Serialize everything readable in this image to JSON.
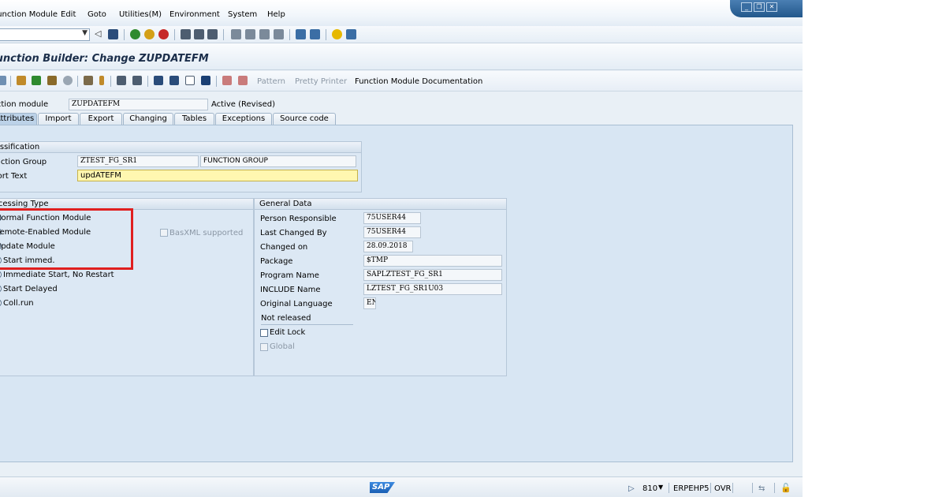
{
  "menu": [
    "Function Module",
    "Edit",
    "Goto",
    "Utilities(M)",
    "Environment",
    "System",
    "Help"
  ],
  "title": "Function Builder: Change ZUPDATEFM",
  "app_toolbar": {
    "pattern": "Pattern",
    "pretty_printer": "Pretty Printer",
    "fm_doc": "Function Module Documentation"
  },
  "header": {
    "fm_label": "Function module",
    "fm_value": "ZUPDATEFM",
    "status": "Active (Revised)"
  },
  "tabs": [
    "Attributes",
    "Import",
    "Export",
    "Changing",
    "Tables",
    "Exceptions",
    "Source code"
  ],
  "classification": {
    "title": "Classification",
    "group_label": "Function Group",
    "group_value": "ZTEST_FG_SR1",
    "group_desc": "FUNCTION GROUP",
    "short_text_label": "Short Text",
    "short_text_value": "updATEFM"
  },
  "processing": {
    "title": "Processing Type",
    "options": [
      "Normal Function Module",
      "Remote-Enabled Module",
      "Update Module"
    ],
    "update_options": [
      "Start immed.",
      "Immediate Start, No Restart",
      "Start Delayed",
      "Coll.run"
    ],
    "basxml": "BasXML supported"
  },
  "general": {
    "title": "General Data",
    "person_label": "Person Responsible",
    "person_value": "75USER44",
    "changed_by_label": "Last Changed By",
    "changed_by_value": "75USER44",
    "changed_on_label": "Changed on",
    "changed_on_value": "28.09.2018",
    "package_label": "Package",
    "package_value": "$TMP",
    "program_label": "Program Name",
    "program_value": "SAPLZTEST_FG_SR1",
    "include_label": "INCLUDE Name",
    "include_value": "LZTEST_FG_SR1U03",
    "lang_label": "Original Language",
    "lang_value": "EN",
    "not_released": "Not released",
    "edit_lock": "Edit Lock",
    "global": "Global"
  },
  "status": {
    "logo": "SAP",
    "client": "810",
    "system": "ERPEHP5",
    "mode": "OVR"
  },
  "colors": {
    "accent_red": "#e01f1f",
    "required_yellow": "#fff7b0",
    "content_bg": "#d8e6f3"
  }
}
